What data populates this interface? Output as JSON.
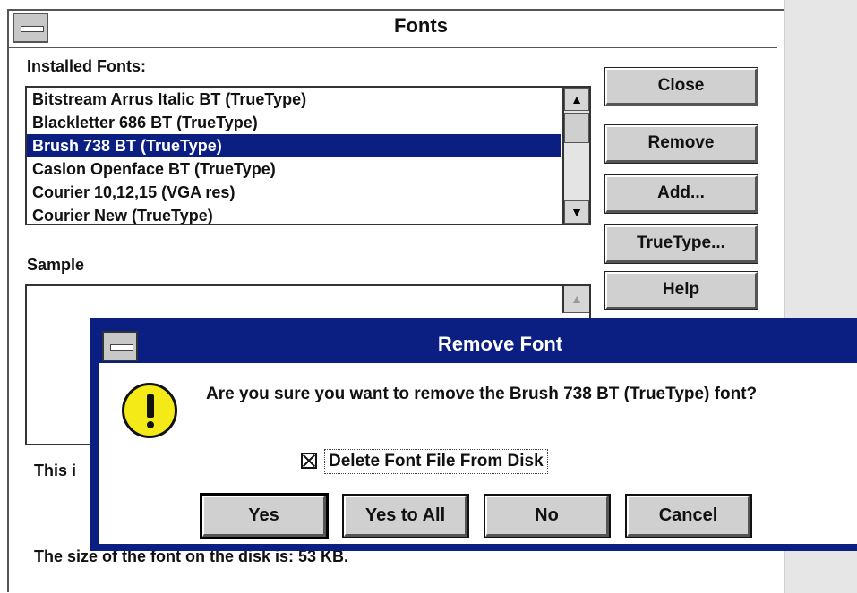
{
  "fonts_window": {
    "title": "Fonts",
    "installed_label": "Installed Fonts:",
    "installed_fonts": [
      "Bitstream Arrus Italic BT (TrueType)",
      "Blackletter 686 BT (TrueType)",
      "Brush 738 BT (TrueType)",
      "Caslon Openface BT (TrueType)",
      "Courier 10,12,15 (VGA res)",
      "Courier New (TrueType)"
    ],
    "selected_font": "Brush 738 BT (TrueType)",
    "sample_label": "Sample",
    "desc_fragment": "This i",
    "size_fragment": "The size of the font on the disk is:  53 KB.",
    "buttons": {
      "close": "Close",
      "remove": "Remove",
      "add": "Add...",
      "truetype": "TrueType...",
      "help": "Help"
    },
    "scroll_up_glyph": "▲",
    "scroll_down_glyph": "▼"
  },
  "remove_dialog": {
    "title": "Remove Font",
    "message": "Are you sure you want to remove the Brush 738 BT (TrueType) font?",
    "checkbox_label": "Delete Font File From Disk",
    "checkbox_checked": true,
    "buttons": {
      "yes": "Yes",
      "yes_to_all": "Yes to All",
      "no": "No",
      "cancel": "Cancel"
    },
    "icon": "warning-exclamation-icon",
    "icon_color": "#f3ea18"
  },
  "colors": {
    "selection": "#0b1e82",
    "dialog_frame": "#0b1e82",
    "button_face": "#d0d0d0"
  }
}
